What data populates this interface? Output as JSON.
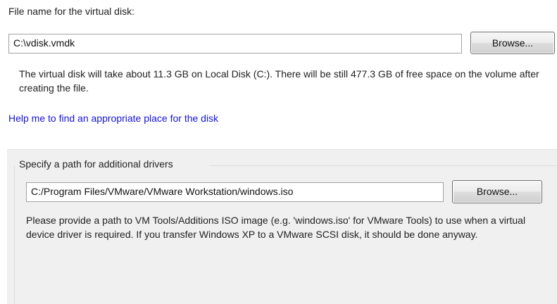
{
  "vdisk": {
    "label": "File name for the virtual disk:",
    "value": "C:\\vdisk.vmdk",
    "browse_label": "Browse...",
    "info": "The virtual disk will take about 11.3 GB on Local Disk (C:). There will be still 477.3 GB of free space on the volume after creating the file.",
    "help_link": "Help me to find an appropriate place for the disk"
  },
  "drivers": {
    "group_title": "Specify a path for additional drivers",
    "value": "C:/Program Files/VMware/VMware Workstation/windows.iso",
    "browse_label": "Browse...",
    "info": "Please provide a path to VM Tools/Additions ISO image (e.g. 'windows.iso' for VMware Tools) to use when a virtual device driver is required. If you transfer Windows XP to a VMware SCSI disk, it should be done anyway."
  },
  "colors": {
    "link": "#1515d8",
    "group_background": "#f0f0f0"
  }
}
